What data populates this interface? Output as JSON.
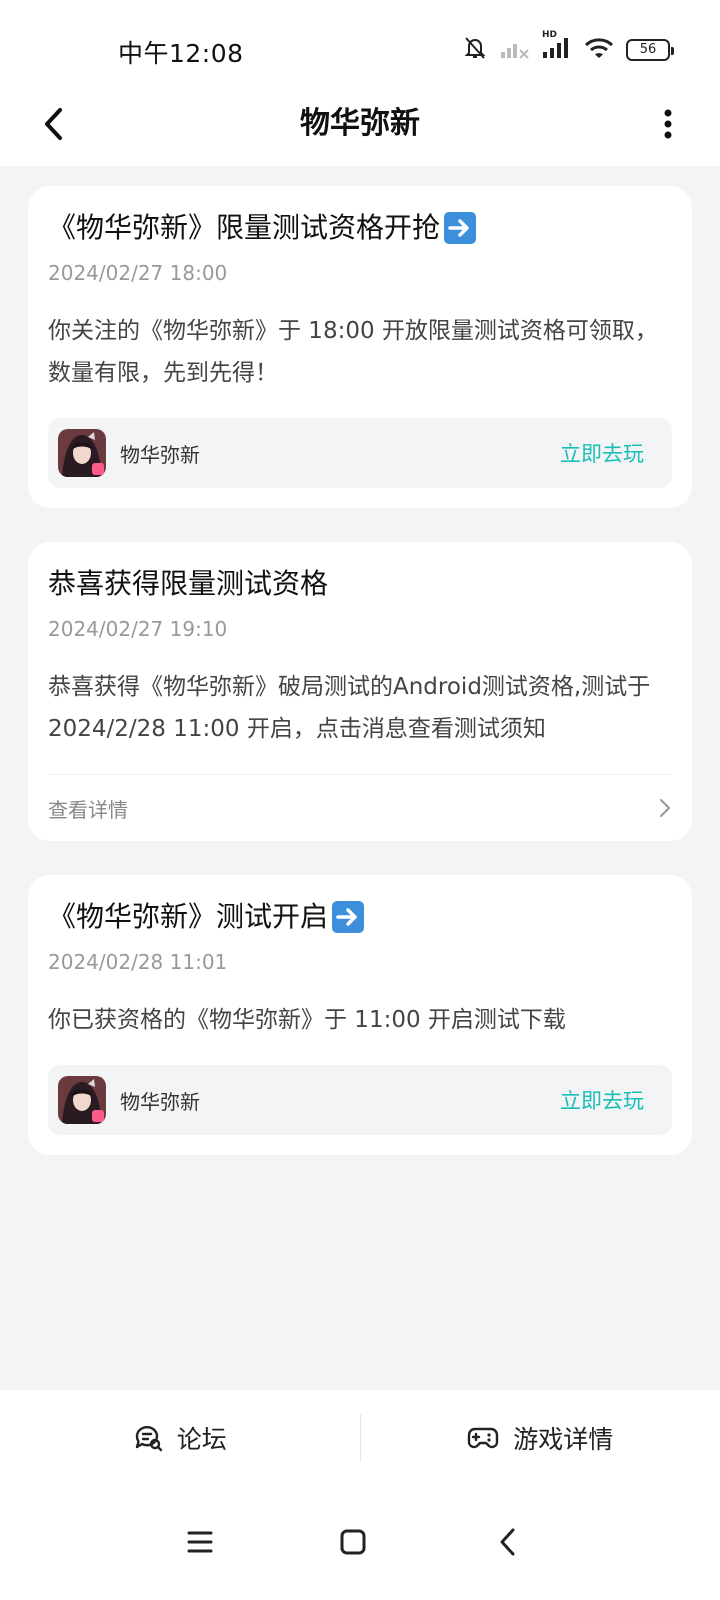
{
  "status_bar": {
    "time": "中午12:08",
    "battery": "56",
    "network_label": "HD",
    "icons": [
      "bell-muted-icon",
      "signal-weak-icon",
      "signal-icon",
      "wifi-icon",
      "battery-icon"
    ]
  },
  "header": {
    "title": "物华弥新",
    "back_icon": "chevron-left-icon",
    "more_icon": "more-vertical-icon"
  },
  "messages": [
    {
      "title": "《物华弥新》限量测试资格开抢",
      "title_emoji": "right-arrow-button-icon",
      "date": "2024/02/27 18:00",
      "body": "你关注的《物华弥新》于 18:00 开放限量测试资格可领取，数量有限，先到先得！",
      "game_name": "物华弥新",
      "action": "立即去玩"
    },
    {
      "title": "恭喜获得限量测试资格",
      "date": "2024/02/27 19:10",
      "body": "恭喜获得《物华弥新》破局测试的Android测试资格,测试于 2024/2/28 11:00 开启，点击消息查看测试须知",
      "detail_label": "查看详情"
    },
    {
      "title": "《物华弥新》测试开启",
      "title_emoji": "right-arrow-button-icon",
      "date": "2024/02/28 11:01",
      "body": "你已获资格的《物华弥新》于 11:00 开启测试下载",
      "game_name": "物华弥新",
      "action": "立即去玩"
    }
  ],
  "bottom_tabs": [
    {
      "label": "论坛",
      "icon": "forum-chat-icon"
    },
    {
      "label": "游戏详情",
      "icon": "gamepad-icon"
    }
  ],
  "nav_bar": [
    "menu-icon",
    "home-square-icon",
    "back-icon"
  ],
  "colors": {
    "accent": "#19bfb5",
    "background": "#f3f4f6",
    "card": "#ffffff",
    "emoji_blue": "#3d8fdc"
  }
}
